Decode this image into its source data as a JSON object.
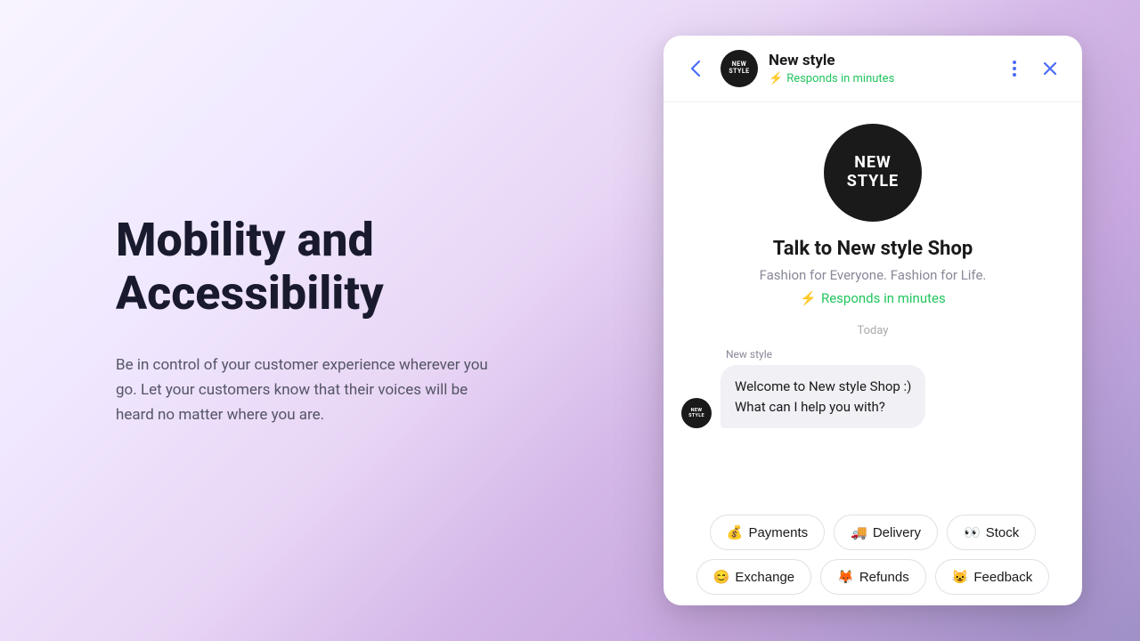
{
  "background": {
    "gradient": "lavender to purple"
  },
  "left": {
    "heading_line1": "Mobility and",
    "heading_line2": "Accessibility",
    "description": "Be in control of your customer experience wherever you go. Let your customers know that their voices will be heard no matter where you are."
  },
  "chat": {
    "header": {
      "shop_name": "New style",
      "status": "Responds in minutes",
      "avatar_line1": "NEW",
      "avatar_line2": "STYLE"
    },
    "body": {
      "logo_line1": "NEW",
      "logo_line2": "STYLE",
      "shop_title": "Talk to New style Shop",
      "tagline": "Fashion for Everyone. Fashion for Life.",
      "responds": "Responds in minutes",
      "today": "Today",
      "sender_label": "New style",
      "message": "Welcome to New style Shop :)\nWhat can I help you with?"
    },
    "quick_replies": {
      "row1": [
        {
          "emoji": "💰",
          "label": "Payments"
        },
        {
          "emoji": "🚚",
          "label": "Delivery"
        },
        {
          "emoji": "👀",
          "label": "Stock"
        }
      ],
      "row2": [
        {
          "emoji": "😊",
          "label": "Exchange"
        },
        {
          "emoji": "🦊",
          "label": "Refunds"
        },
        {
          "emoji": "😺",
          "label": "Feedback"
        }
      ]
    }
  }
}
